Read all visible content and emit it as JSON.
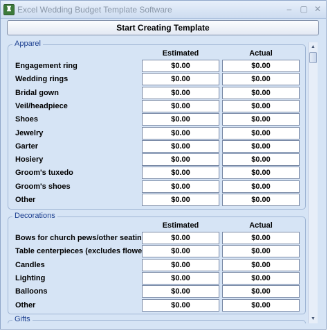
{
  "window": {
    "title": "Excel Wedding Budget Template Software",
    "minimize_glyph": "‒",
    "maximize_glyph": "▢",
    "close_glyph": "✕"
  },
  "toolbar": {
    "start_label": "Start Creating Template"
  },
  "columns": {
    "estimated": "Estimated",
    "actual": "Actual"
  },
  "apparel": {
    "label": "Apparel",
    "rows": [
      {
        "label": "Engagement ring",
        "estimated": "$0.00",
        "actual": "$0.00"
      },
      {
        "label": "Wedding rings",
        "estimated": "$0.00",
        "actual": "$0.00"
      },
      {
        "label": "Bridal gown",
        "estimated": "$0.00",
        "actual": "$0.00"
      },
      {
        "label": "Veil/headpiece",
        "estimated": "$0.00",
        "actual": "$0.00"
      },
      {
        "label": "Shoes",
        "estimated": "$0.00",
        "actual": "$0.00"
      },
      {
        "label": "Jewelry",
        "estimated": "$0.00",
        "actual": "$0.00"
      },
      {
        "label": "Garter",
        "estimated": "$0.00",
        "actual": "$0.00"
      },
      {
        "label": "Hosiery",
        "estimated": "$0.00",
        "actual": "$0.00"
      },
      {
        "label": "Groom's tuxedo",
        "estimated": "$0.00",
        "actual": "$0.00"
      },
      {
        "label": "Groom's shoes",
        "estimated": "$0.00",
        "actual": "$0.00"
      },
      {
        "label": "Other",
        "estimated": "$0.00",
        "actual": "$0.00"
      }
    ]
  },
  "decorations": {
    "label": "Decorations",
    "rows": [
      {
        "label": "Bows for church pews/other seating",
        "estimated": "$0.00",
        "actual": "$0.00"
      },
      {
        "label": "Table centerpieces (excludes flowers)",
        "estimated": "$0.00",
        "actual": "$0.00"
      },
      {
        "label": "Candles",
        "estimated": "$0.00",
        "actual": "$0.00"
      },
      {
        "label": "Lighting",
        "estimated": "$0.00",
        "actual": "$0.00"
      },
      {
        "label": "Balloons",
        "estimated": "$0.00",
        "actual": "$0.00"
      },
      {
        "label": "Other",
        "estimated": "$0.00",
        "actual": "$0.00"
      }
    ]
  },
  "gifts": {
    "label": "Gifts"
  }
}
